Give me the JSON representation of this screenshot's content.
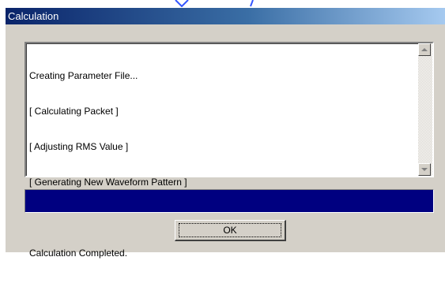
{
  "window": {
    "title": "Calculation"
  },
  "log": {
    "lines": [
      "Creating Parameter File...",
      "[ Calculating Packet ]",
      "[ Adjusting RMS Value ]",
      "[ Generating New Waveform Pattern ]",
      "",
      "Calculation Completed."
    ]
  },
  "progress": {
    "value_fraction": 1.0,
    "fill_color": "#000080"
  },
  "buttons": {
    "ok_label": "OK"
  },
  "icons": {
    "scroll_up": "triangle-up-icon",
    "scroll_down": "triangle-down-icon"
  },
  "colors": {
    "dialog_face": "#d4d0c8",
    "titlebar_start": "#0a246a",
    "titlebar_end": "#a6caf0",
    "progress": "#000080"
  }
}
